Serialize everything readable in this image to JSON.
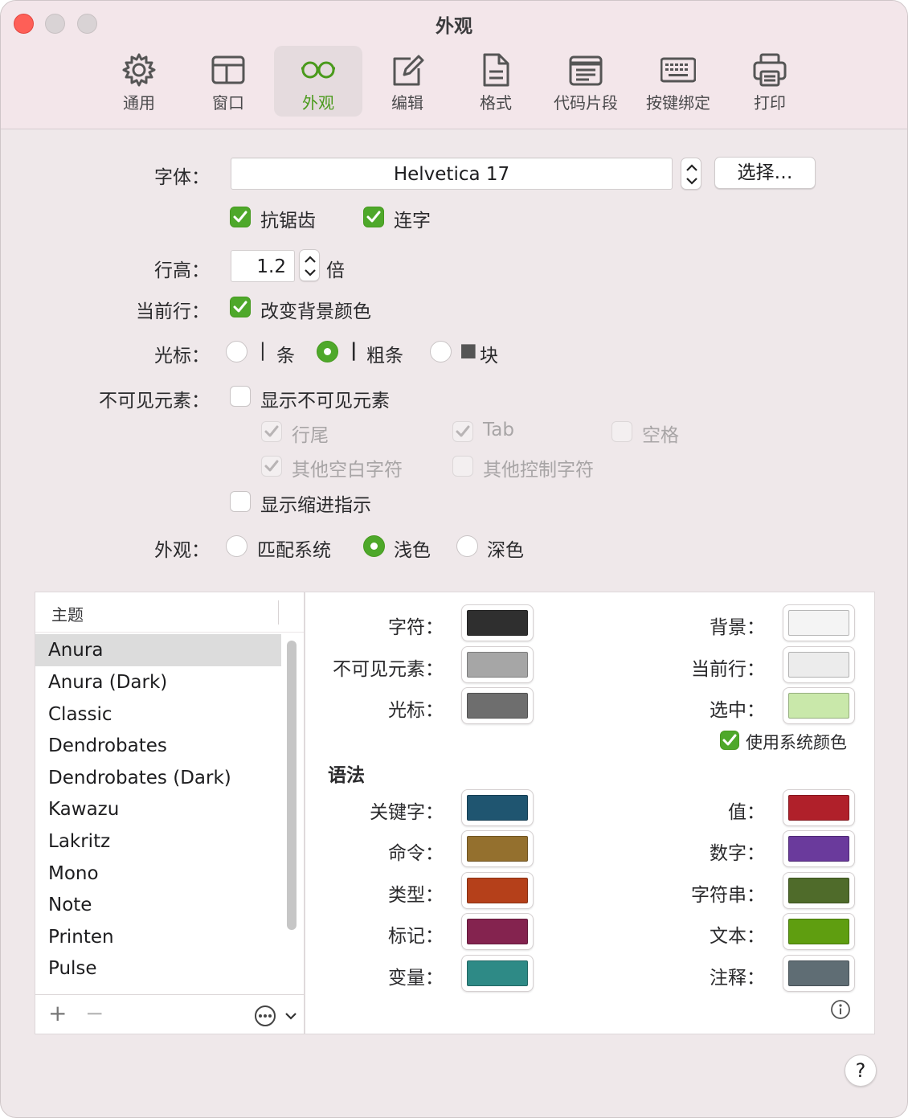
{
  "window": {
    "title": "外观"
  },
  "toolbar": {
    "items": [
      {
        "label": "通用",
        "icon": "gear-icon"
      },
      {
        "label": "窗口",
        "icon": "window-layout-icon"
      },
      {
        "label": "外观",
        "icon": "glasses-icon",
        "active": true
      },
      {
        "label": "编辑",
        "icon": "pencil-square-icon"
      },
      {
        "label": "格式",
        "icon": "document-icon"
      },
      {
        "label": "代码片段",
        "icon": "snippet-icon"
      },
      {
        "label": "按键绑定",
        "icon": "keyboard-icon"
      },
      {
        "label": "打印",
        "icon": "printer-icon"
      }
    ],
    "accent": "#4a9a1c"
  },
  "font": {
    "label": "字体：",
    "value": "Helvetica 17",
    "choose_button": "选择…",
    "antialias": {
      "label": "抗锯齿",
      "checked": true
    },
    "ligatures": {
      "label": "连字",
      "checked": true
    }
  },
  "line_height": {
    "label": "行高：",
    "value": "1.2",
    "unit": "倍"
  },
  "current_line": {
    "label": "当前行：",
    "option": "改变背景颜色",
    "checked": true
  },
  "cursor": {
    "label": "光标：",
    "options": [
      {
        "glyph": "|",
        "label": "条",
        "selected": false
      },
      {
        "glyph": "|",
        "label": "粗条",
        "selected": true
      },
      {
        "glyph": "■",
        "label": "块",
        "selected": false
      }
    ]
  },
  "invisibles": {
    "label": "不可见元素：",
    "show": {
      "label": "显示不可见元素",
      "checked": false
    },
    "line_end": {
      "label": "行尾",
      "checked": true
    },
    "tab": {
      "label": "Tab",
      "checked": true
    },
    "space": {
      "label": "空格",
      "checked": false
    },
    "other_whitespace": {
      "label": "其他空白字符",
      "checked": true
    },
    "other_control": {
      "label": "其他控制字符",
      "checked": false
    },
    "indent_guides": {
      "label": "显示缩进指示",
      "checked": false
    }
  },
  "appearance": {
    "label": "外观：",
    "options": [
      {
        "label": "匹配系统",
        "selected": false
      },
      {
        "label": "浅色",
        "selected": true
      },
      {
        "label": "深色",
        "selected": false
      }
    ]
  },
  "themes": {
    "header": "主题",
    "items": [
      "Anura",
      "Anura (Dark)",
      "Classic",
      "Dendrobates",
      "Dendrobates (Dark)",
      "Kawazu",
      "Lakritz",
      "Mono",
      "Note",
      "Printen",
      "Pulse"
    ],
    "selected": "Anura",
    "add_label": "+",
    "remove_label": "−"
  },
  "colors": {
    "text": {
      "label": "字符：",
      "color": "#2f2f2f"
    },
    "invisibles": {
      "label": "不可见元素：",
      "color": "#a6a6a6"
    },
    "cursor": {
      "label": "光标：",
      "color": "#6e6e6e"
    },
    "background": {
      "label": "背景：",
      "color": "#f4f4f4"
    },
    "current_line": {
      "label": "当前行：",
      "color": "#ececec"
    },
    "selection": {
      "label": "选中：",
      "color": "#c9e8aa"
    },
    "use_system": {
      "label": "使用系统颜色",
      "checked": true
    }
  },
  "syntax": {
    "heading": "语法",
    "left": [
      {
        "label": "关键字：",
        "color": "#1f5570"
      },
      {
        "label": "命令：",
        "color": "#94702e"
      },
      {
        "label": "类型：",
        "color": "#b5401a"
      },
      {
        "label": "标记：",
        "color": "#84234f"
      },
      {
        "label": "变量：",
        "color": "#2e8a86"
      }
    ],
    "right": [
      {
        "label": "值：",
        "color": "#b0202a"
      },
      {
        "label": "数字：",
        "color": "#6a3a9c"
      },
      {
        "label": "字符串：",
        "color": "#4f6b2a"
      },
      {
        "label": "文本：",
        "color": "#5f9e10"
      },
      {
        "label": "注释：",
        "color": "#5f6d74"
      }
    ]
  },
  "help_label": "?"
}
